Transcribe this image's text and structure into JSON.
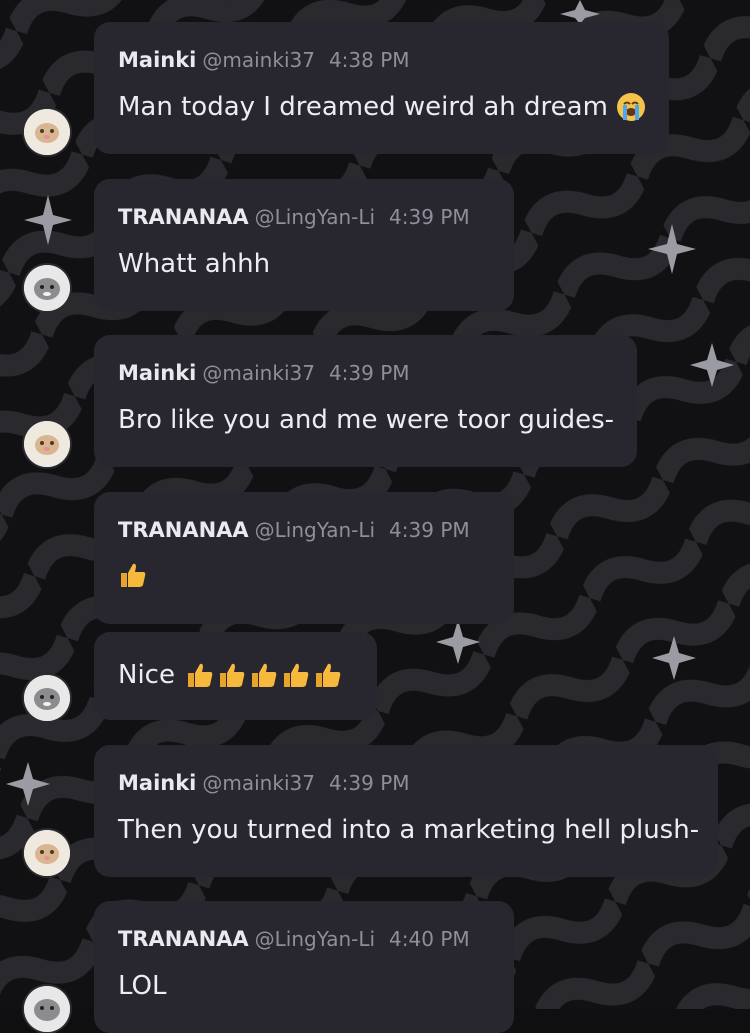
{
  "messages": [
    {
      "user": "Mainki",
      "handle": "@mainki37",
      "time": "4:38 PM",
      "text": "Man today I dreamed weird ah dream",
      "emoji": "loudly-crying-face"
    },
    {
      "user": "TRANANAA",
      "handle": "@LingYan-Li",
      "time": "4:39 PM",
      "text": "Whatt ahhh"
    },
    {
      "user": "Mainki",
      "handle": "@mainki37",
      "time": "4:39 PM",
      "text": "Bro like you and me were toor guides-"
    },
    {
      "user": "TRANANAA",
      "handle": "@LingYan-Li",
      "time": "4:39 PM",
      "text": "",
      "emoji": "thumbs-up"
    },
    {
      "text": "Nice",
      "emoji": "thumbs-up",
      "emoji_count": 5
    },
    {
      "user": "Mainki",
      "handle": "@mainki37",
      "time": "4:39 PM",
      "text": "Then you turned into a marketing hell plush-"
    },
    {
      "user": "TRANANAA",
      "handle": "@LingYan-Li",
      "time": "4:40 PM",
      "text": "LOL"
    }
  ],
  "colors": {
    "bubble": "#28272f",
    "background": "#0f0f12",
    "name": "#e9e9ee",
    "meta": "#8f8e99",
    "thumb": "#f6b93b"
  }
}
